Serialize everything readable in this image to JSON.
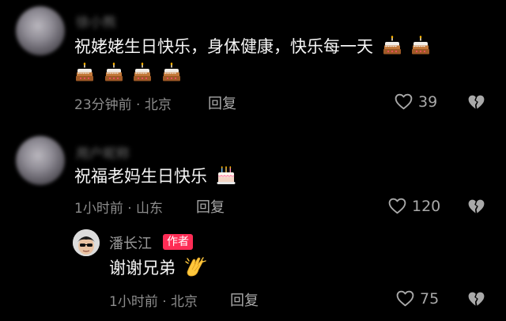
{
  "comments": [
    {
      "username": "徐小熊",
      "text": "祝姥姥生日快乐，身体健康，快乐每一天",
      "time": "23分钟前 · 北京",
      "reply_label": "回复",
      "likes": "39",
      "emoji": "cake-icon"
    },
    {
      "username": "用户昵称",
      "text": "祝福老妈生日快乐",
      "time": "1小时前 · 山东",
      "reply_label": "回复",
      "likes": "120",
      "emoji": "birthday-cake-icon"
    }
  ],
  "reply": {
    "username": "潘长江",
    "badge": "作者",
    "text": "谢谢兄弟",
    "time": "1小时前 · 北京",
    "reply_label": "回复",
    "likes": "75",
    "emoji": "clapping-hands-icon"
  },
  "colors": {
    "background": "#000000",
    "badge": "#fe2c55",
    "meta_text": "#8c8c8c",
    "icon": "#a9a9a9"
  }
}
